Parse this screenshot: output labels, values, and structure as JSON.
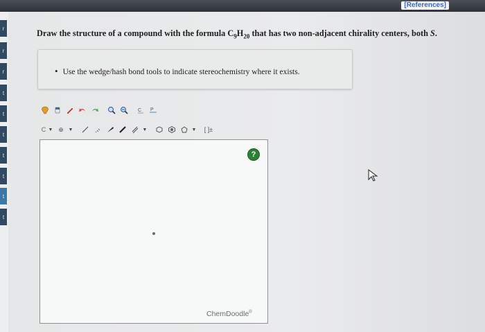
{
  "header": {
    "references_label": "[References]"
  },
  "leftnav": {
    "tab_glyphs": [
      "r",
      "r",
      "r",
      "t",
      "t",
      "t",
      "t",
      "t",
      "t",
      "t"
    ]
  },
  "question": {
    "prefix": "Draw the structure of a compound with the formula C",
    "sub1": "9",
    "mid": "H",
    "sub2": "20",
    "suffix": " that has two non-adjacent chirality centers, both ",
    "config": "S",
    "end": "."
  },
  "instructions": {
    "items": [
      "Use the wedge/hash bond tools to indicate stereochemistry where it exists."
    ]
  },
  "editor": {
    "toolbar1": [
      "lasso-icon",
      "eraser-icon",
      "pencil-icon",
      "undo-icon",
      "redo-icon",
      "zoom-in-icon",
      "zoom-out-icon",
      "clean-icon",
      "periodic-table-icon"
    ],
    "toolbar2": {
      "atom_label": "C",
      "charge_label": "⊕",
      "bracket_label": "[ ]±"
    },
    "help_label": "?",
    "brand_label": "ChemDoodle",
    "brand_mark": "®"
  },
  "colors": {
    "topbar": "#2f3338",
    "reference_link": "#3a66c8",
    "nav_tab": "#2f4a61",
    "help_button": "#2f7f3a"
  }
}
